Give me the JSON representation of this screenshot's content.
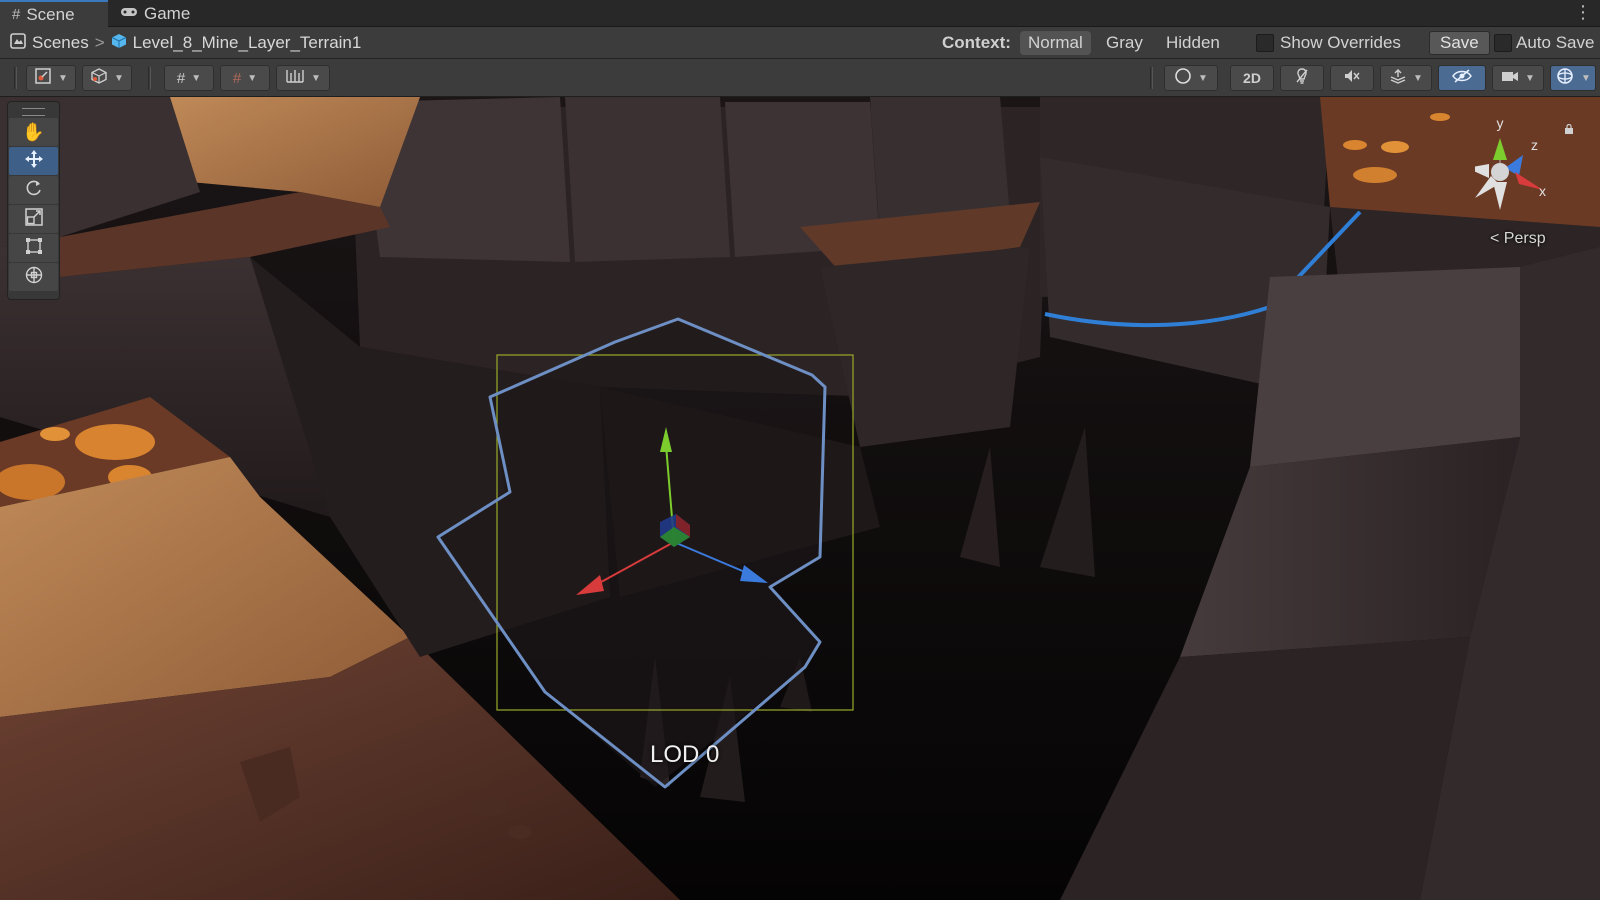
{
  "tabs": [
    {
      "label": "Scene",
      "icon": "hash-icon",
      "active": true
    },
    {
      "label": "Game",
      "icon": "gamepad-icon",
      "active": false
    }
  ],
  "breadcrumb": {
    "root": "Scenes",
    "separator": ">",
    "current": "Level_8_Mine_Layer_Terrain1"
  },
  "context": {
    "label": "Context:",
    "options": [
      "Normal",
      "Gray",
      "Hidden"
    ],
    "selected": "Normal"
  },
  "show_overrides": {
    "label": "Show Overrides",
    "checked": false
  },
  "save_label": "Save",
  "auto_save": {
    "label": "Auto Save",
    "checked": false
  },
  "toolbar": {
    "mode_2d_label": "2D"
  },
  "tools": [
    "hand-tool",
    "move-tool",
    "rotate-tool",
    "scale-tool",
    "rect-tool",
    "transform-tool"
  ],
  "active_tool": "move-tool",
  "gizmo": {
    "y_label": "y",
    "z_label": "z",
    "x_label": "x",
    "projection": "Persp",
    "colors": {
      "x": "#d83b3b",
      "y": "#7ccc2e",
      "z": "#3a7bdd"
    }
  },
  "selection": {
    "lod_label": "LOD 0",
    "outline_color": "#6d8fc4",
    "bounds_color": "#9aaa2a"
  },
  "colors": {
    "accent": "#3a79bb",
    "active_button": "#4b6b93"
  }
}
